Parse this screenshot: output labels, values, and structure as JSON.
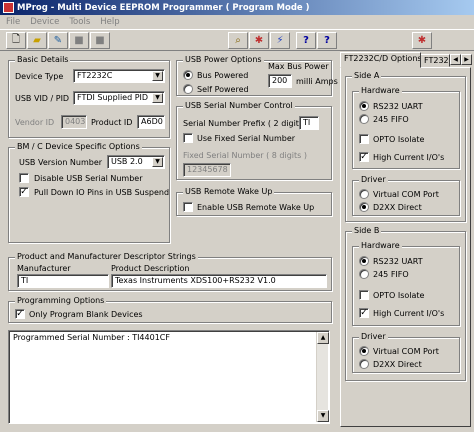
{
  "window": {
    "title": "MProg - Multi Device EEPROM Programmer ( Program Mode )"
  },
  "menu": {
    "items": [
      "File",
      "Device",
      "Tools",
      "Help"
    ]
  },
  "basic": {
    "legend": "Basic Details",
    "device_type_label": "Device Type",
    "device_type_value": "FT2232C",
    "usb_vidpid_label": "USB VID / PID",
    "usb_vidpid_value": "FTDI Supplied PID",
    "vendor_id_label": "Vendor ID",
    "vendor_id_value": "0403",
    "product_id_label": "Product ID",
    "product_id_value": "A6D0"
  },
  "bmc": {
    "legend": "BM / C Device Specific Options",
    "usb_version_label": "USB Version Number",
    "usb_version_value": "USB 2.0",
    "disable_serial_label": "Disable USB Serial Number",
    "pull_down_label": "Pull Down IO Pins in USB Suspend"
  },
  "power": {
    "legend": "USB Power Options",
    "bus_powered_label": "Bus Powered",
    "self_powered_label": "Self Powered",
    "max_bus_power_label": "Max Bus Power",
    "max_bus_power_value": "200",
    "milli_amps_label": "milli Amps"
  },
  "serial": {
    "legend": "USB Serial Number Control",
    "prefix_label": "Serial Number Prefix ( 2 digits )",
    "prefix_value": "TI",
    "use_fixed_label": "Use Fixed Serial Number",
    "fixed_label": "Fixed Serial Number ( 8 digits )",
    "fixed_value": "12345678"
  },
  "wake": {
    "legend": "USB Remote Wake Up",
    "enable_label": "Enable USB Remote Wake Up"
  },
  "descriptor": {
    "legend": "Product and Manufacturer Descriptor Strings",
    "manufacturer_label": "Manufacturer",
    "manufacturer_value": "TI",
    "product_desc_label": "Product Description",
    "product_desc_value": "Texas Instruments XDS100+RS232 V1.0"
  },
  "programming": {
    "legend": "Programming Options",
    "only_blank_label": "Only Program Blank Devices"
  },
  "output": {
    "text": "Programmed Serial Number : TI4401CF"
  },
  "tabs": {
    "tab1": "FT2232C/D Options",
    "tab2": "FT232"
  },
  "sideA": {
    "legend": "Side A",
    "hardware_legend": "Hardware",
    "rs232": "RS232 UART",
    "fifo": "245 FIFO",
    "opto": "OPTO Isolate",
    "high_current": "High Current I/O's",
    "driver_legend": "Driver",
    "vcp": "Virtual COM Port",
    "d2xx": "D2XX Direct"
  },
  "sideB": {
    "legend": "Side B",
    "hardware_legend": "Hardware",
    "rs232": "RS232 UART",
    "fifo": "245 FIFO",
    "opto": "OPTO Isolate",
    "high_current": "High Current I/O's",
    "driver_legend": "Driver",
    "vcp": "Virtual COM Port",
    "d2xx": "D2XX Direct"
  },
  "colors": {
    "title_start": "#0a246a",
    "title_end": "#a6caf0",
    "face": "#d4d0c8"
  }
}
